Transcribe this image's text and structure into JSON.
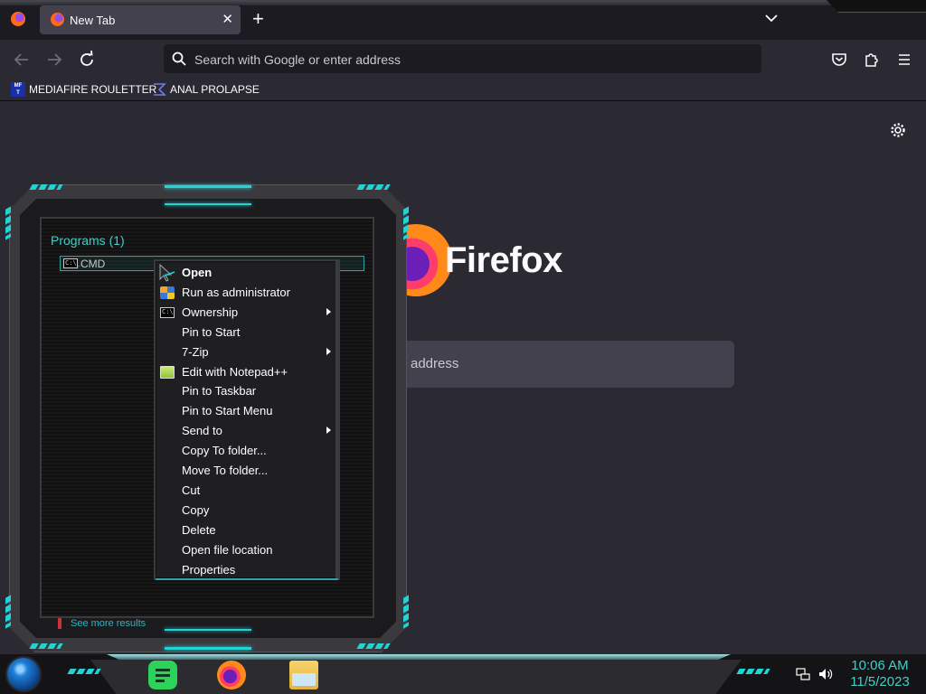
{
  "browser": {
    "tab": {
      "title": "New Tab",
      "close": "✕"
    },
    "new_tab": "+",
    "urlbar": {
      "placeholder": "Search with Google or enter address"
    },
    "bookmarks": [
      {
        "label": "MEDIAFIRE ROULETTER",
        "icon": "MF",
        "icon_sub": "T"
      },
      {
        "label": "ANAL PROLAPSE"
      }
    ],
    "newtab_page": {
      "brand": "Firefox",
      "search_placeholder": "address"
    }
  },
  "start_menu": {
    "programs_header": "Programs (1)",
    "program": {
      "label": "CMD",
      "icon_text": "C:\\_"
    },
    "see_more": "See more results"
  },
  "context_menu": {
    "items": [
      {
        "label": "Open",
        "bold": true,
        "icon": "cursor-icon"
      },
      {
        "label": "Run as administrator",
        "icon": "uac-shield-icon"
      },
      {
        "label": "Ownership",
        "icon": "cmd-icon",
        "submenu": true
      },
      {
        "label": "Pin to Start"
      },
      {
        "label": "7-Zip",
        "submenu": true
      },
      {
        "label": "Edit with Notepad++",
        "icon": "notepadpp-icon"
      },
      {
        "label": "Pin to Taskbar"
      },
      {
        "label": "Pin to Start Menu"
      },
      {
        "label": "Send to",
        "submenu": true
      },
      {
        "label": "Copy To folder..."
      },
      {
        "label": "Move To folder..."
      },
      {
        "label": "Cut"
      },
      {
        "label": "Copy"
      },
      {
        "label": "Delete"
      },
      {
        "label": "Open file location"
      },
      {
        "label": "Properties"
      }
    ]
  },
  "taskbar": {
    "time": "10:06 AM",
    "date": "11/5/2023"
  },
  "colors": {
    "accent_cyan": "#22d3d6",
    "firefox_bg": "#2b2a33",
    "clock_text": "#3fd0c9"
  }
}
